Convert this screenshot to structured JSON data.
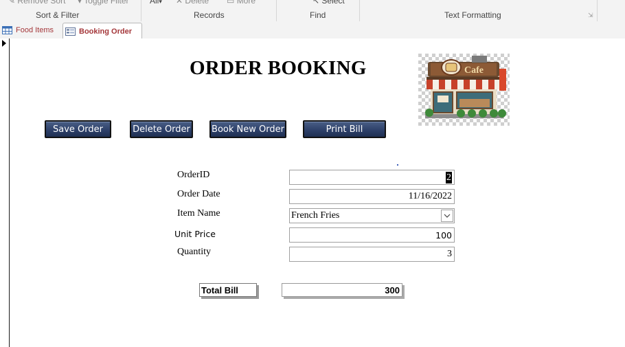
{
  "ribbon": {
    "top_items": [
      "Remove Sort",
      "Toggle Filter",
      "All",
      "Delete",
      "More",
      "Select"
    ],
    "groups": [
      "Sort & Filter",
      "Records",
      "Find",
      "Text Formatting"
    ]
  },
  "tabs": [
    {
      "label": "Food Items",
      "icon": "table-icon",
      "active": false
    },
    {
      "label": "Booking Order",
      "icon": "form-icon",
      "active": true
    }
  ],
  "form": {
    "title": "ORDER BOOKING",
    "image": "cafe-storefront-image",
    "image_sign": "Cafe",
    "buttons": {
      "save": "Save Order",
      "delete": "Delete Order",
      "new": "Book New Order",
      "print": "Print Bill"
    },
    "fields": {
      "order_id": {
        "label": "OrderID",
        "value": "2"
      },
      "order_date": {
        "label": "Order Date",
        "value": "11/16/2022"
      },
      "item_name": {
        "label": "Item Name",
        "value": "French Fries"
      },
      "unit_price": {
        "label": "Unit Price",
        "value": "100"
      },
      "quantity": {
        "label": "Quantity",
        "value": "3"
      }
    },
    "total": {
      "label": "Total Bill",
      "value": "300"
    }
  },
  "colors": {
    "button_fill": "#2e416a",
    "tab_text": "#a4373a",
    "ribbon_bg": "#f3f3f3"
  }
}
